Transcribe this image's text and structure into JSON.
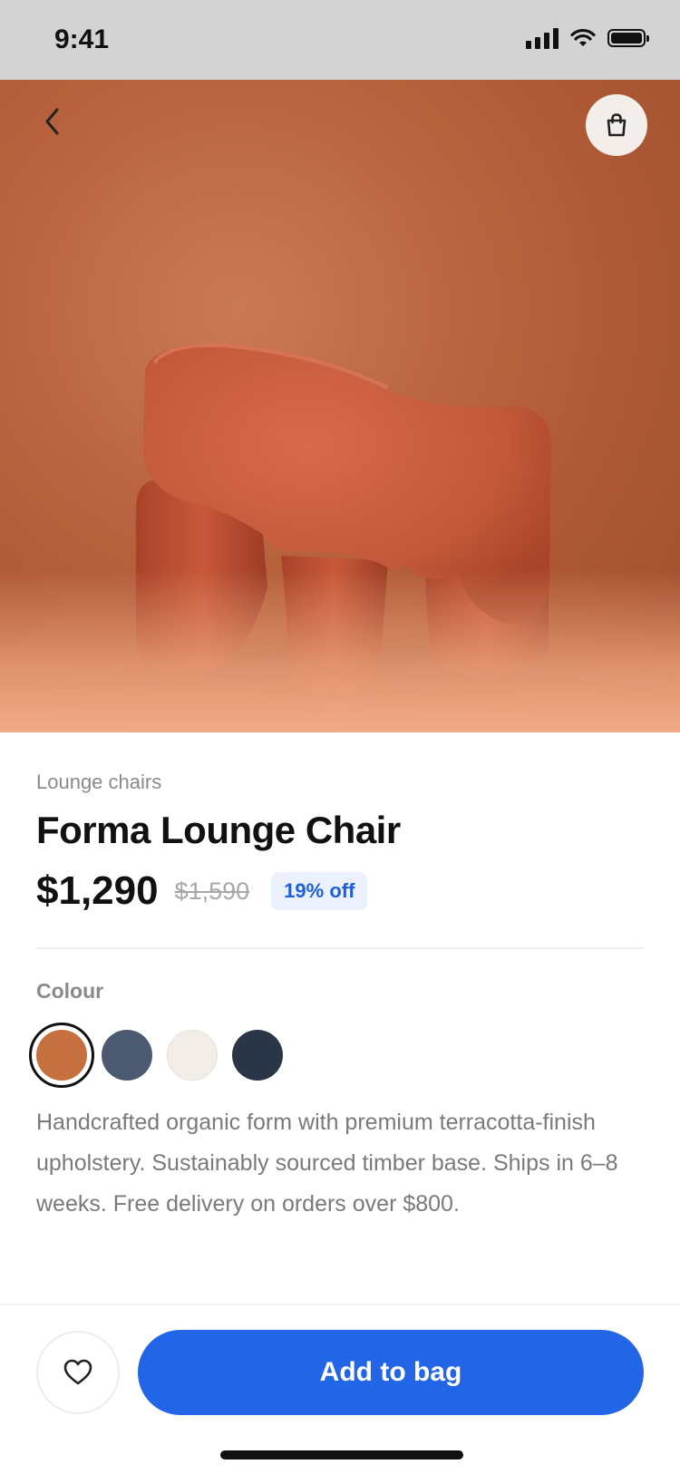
{
  "status_bar": {
    "time": "9:41"
  },
  "product": {
    "category": "Lounge chairs",
    "title": "Forma Lounge Chair",
    "price": "$1,290",
    "original_price": "$1,590",
    "discount_badge": "19% off"
  },
  "colour": {
    "label": "Colour",
    "options": [
      {
        "name": "terracotta",
        "color": "#c6703f",
        "selected": true
      },
      {
        "name": "slate",
        "color": "#4b5a70",
        "selected": false
      },
      {
        "name": "cream",
        "color": "#f2ede6",
        "selected": false
      },
      {
        "name": "navy",
        "color": "#2b3548",
        "selected": false
      }
    ]
  },
  "description": "Handcrafted organic form with premium terracotta-finish upholstery. Sustainably sourced timber base. Ships in 6–8 weeks. Free delivery on orders over $800.",
  "actions": {
    "add_to_bag_label": "Add to bag"
  },
  "icons": {
    "back": "chevron-left-icon",
    "bag": "shopping-bag-icon",
    "wishlist": "heart-icon"
  },
  "theme": {
    "accent": "#2265e6",
    "discount_bg": "#eaf1fd"
  }
}
